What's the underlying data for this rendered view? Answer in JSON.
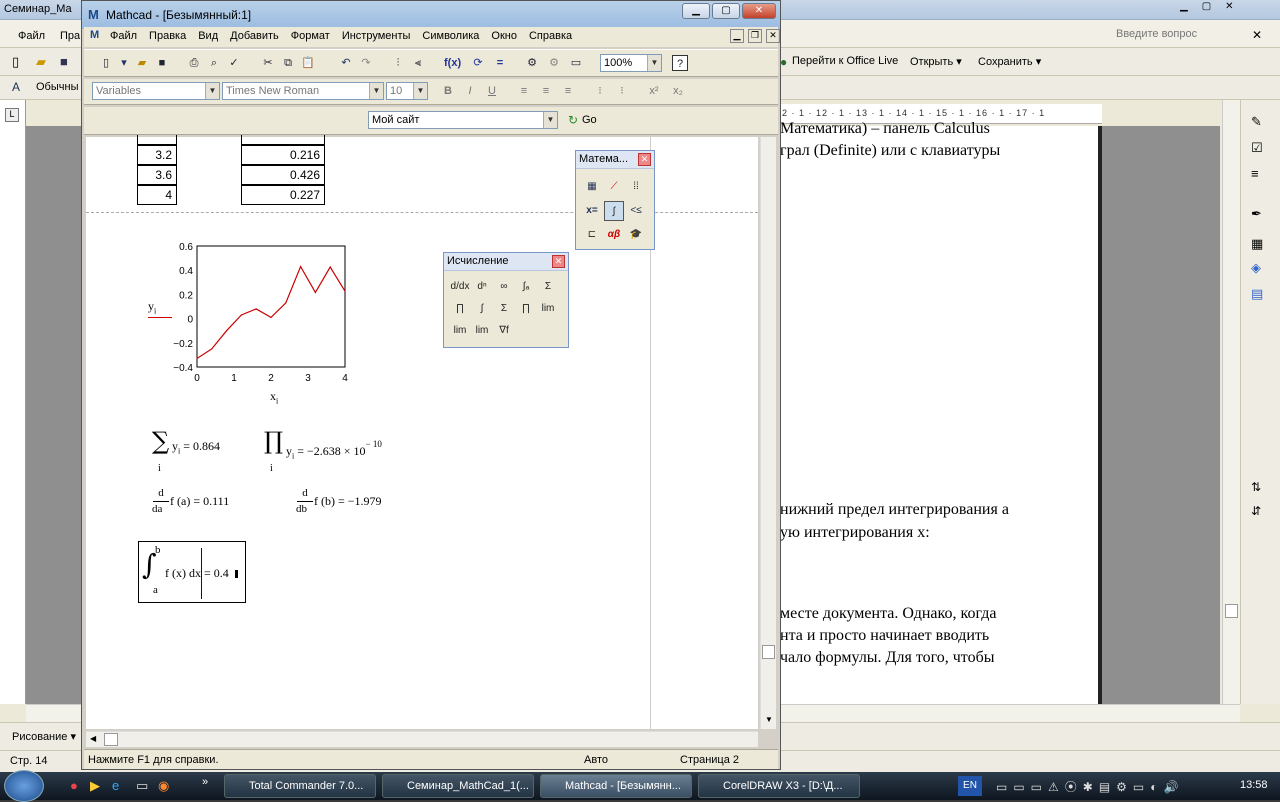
{
  "word": {
    "title": "Семинар_Ма",
    "help_placeholder": "Введите вопрос",
    "menu": [
      "Файл",
      "Пра"
    ],
    "style_value": "Обычны",
    "office_links": [
      "Перейти к Office Live",
      "Открыть ▾",
      "Сохранить ▾"
    ],
    "ruler": "2 · 1 · 12 · 1 · 13 · 1 · 14 · 1 · 15 · 1 · 16 · 1 · 17 · 1",
    "lines": [
      "Математика) – панель Calculus",
      "грал (Definite) или с клавиатуры",
      "нижний предел интегрирования а",
      "ую интегрирования x:",
      "месте документа. Однако, когда",
      "нта и просто начинает вводить",
      "чало формулы. Для того, чтобы"
    ],
    "drawing_label": "Рисование ▾",
    "status": "Стр. 14"
  },
  "mathcad": {
    "title": "Mathcad - [Безымянный:1]",
    "menu": [
      "Файл",
      "Правка",
      "Вид",
      "Добавить",
      "Формат",
      "Инструменты",
      "Символика",
      "Окно",
      "Справка"
    ],
    "zoom": "100%",
    "style_combo": "Variables",
    "font_combo": "Times New Roman",
    "size_combo": "10",
    "site_combo": "Мой сайт",
    "go_label": "Go",
    "table_x": [
      "3.2",
      "3.6",
      "4"
    ],
    "table_y": [
      "0.216",
      "0.426",
      "0.227"
    ],
    "sum_expr": "y",
    "sum_sub": "i",
    "sum_value": "= 0.864",
    "prod_value": "= −2.638 × 10",
    "prod_exp": "− 10",
    "deriv_a_value": "f (a) = 0.111",
    "deriv_b_value": "f (b) = −1.979",
    "deriv_a_den": "da",
    "deriv_b_den": "db",
    "deriv_num": "d",
    "integral_body": "f (x) dx = 0.4",
    "integral_upper": "b",
    "integral_lower": "a",
    "status_help": "Нажмите F1 для справки.",
    "status_mode": "Авто",
    "status_page": "Страница 2"
  },
  "math_palette": {
    "title": "Матема..."
  },
  "calculus_palette": {
    "title": "Исчисление"
  },
  "chart_data": {
    "type": "line",
    "x": [
      0,
      0.4,
      0.8,
      1.2,
      1.6,
      2.0,
      2.4,
      2.8,
      3.2,
      3.6,
      4.0
    ],
    "series": [
      {
        "values": [
          -0.33,
          -0.25,
          -0.1,
          0.03,
          0.08,
          0.01,
          0.13,
          0.43,
          0.216,
          0.426,
          0.227
        ]
      }
    ],
    "xlabel": "x",
    "xlabel_sub": "i",
    "ylabel": "y",
    "ylabel_sub": "i",
    "xlim": [
      0,
      4
    ],
    "ylim": [
      -0.4,
      0.6
    ],
    "xticks": [
      "0",
      "1",
      "2",
      "3",
      "4"
    ],
    "yticks": [
      "0.6",
      "0.4",
      "0.2",
      "0",
      "−0.2",
      "−0.4"
    ],
    "color": "#cc0000"
  },
  "taskbar": {
    "tasks": [
      "Total Commander 7.0...",
      "Семинар_MathCad_1(...",
      "Mathcad - [Безымянн...",
      "CorelDRAW X3 - [D:\\Д..."
    ],
    "lang": "EN",
    "clock": "13:58"
  }
}
